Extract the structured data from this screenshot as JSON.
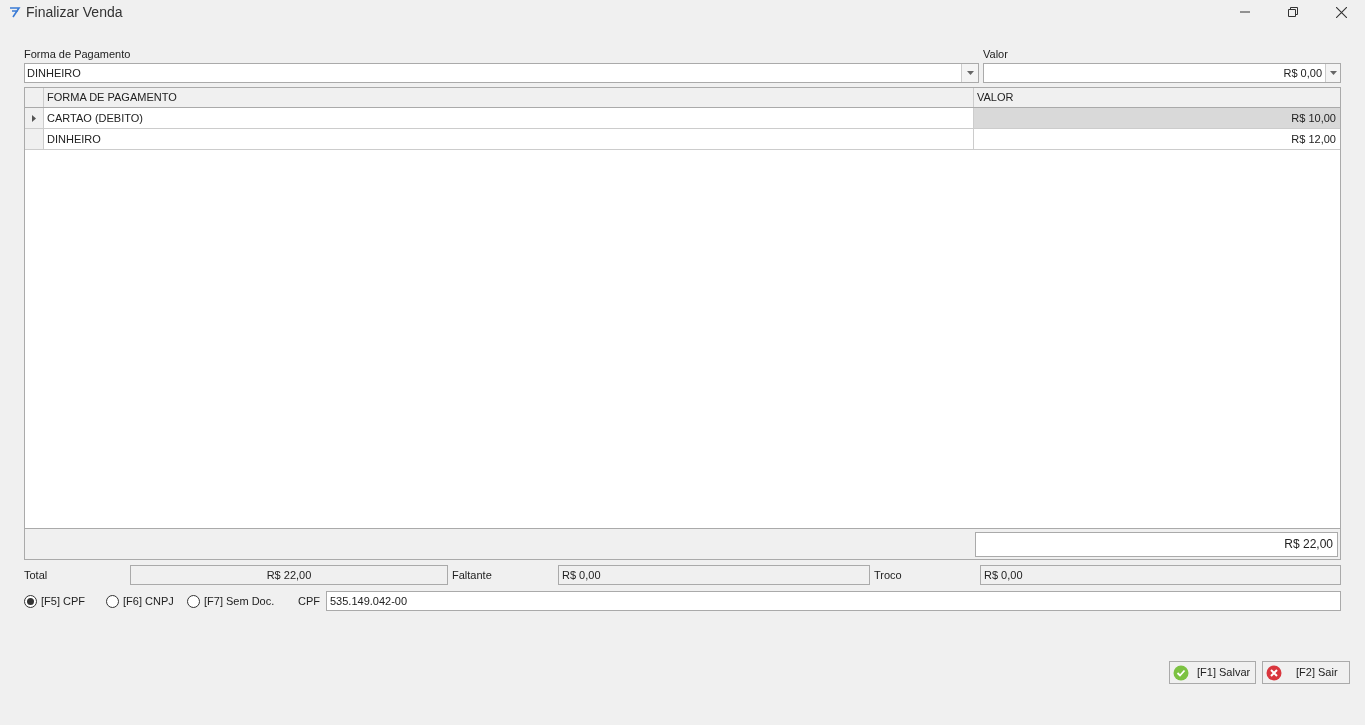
{
  "window": {
    "title": "Finalizar Venda"
  },
  "payment_method": {
    "label": "Forma de Pagamento",
    "value": "DINHEIRO"
  },
  "amount": {
    "label": "Valor",
    "value": "R$ 0,00"
  },
  "table": {
    "columns": [
      "FORMA DE PAGAMENTO",
      "VALOR"
    ],
    "rows": [
      {
        "method": "CARTAO (DEBITO)",
        "value": "R$ 10,00",
        "selected": true
      },
      {
        "method": "DINHEIRO",
        "value": "R$ 12,00",
        "selected": false
      }
    ],
    "footer_total": "R$ 22,00"
  },
  "summary": [
    {
      "label": "Total",
      "value": "R$ 22,00"
    },
    {
      "label": "Faltante",
      "value": "R$ 0,00"
    },
    {
      "label": "Troco",
      "value": "R$ 0,00"
    }
  ],
  "document_types": [
    {
      "label": "[F5] CPF",
      "selected": true
    },
    {
      "label": "[F6] CNPJ",
      "selected": false
    },
    {
      "label": "[F7] Sem Doc.",
      "selected": false
    }
  ],
  "document": {
    "label": "CPF",
    "value": "535.149.042-00"
  },
  "buttons": [
    {
      "label": "[F1] Salvar",
      "kind": "save"
    },
    {
      "label": "[F2] Sair",
      "kind": "exit"
    }
  ]
}
